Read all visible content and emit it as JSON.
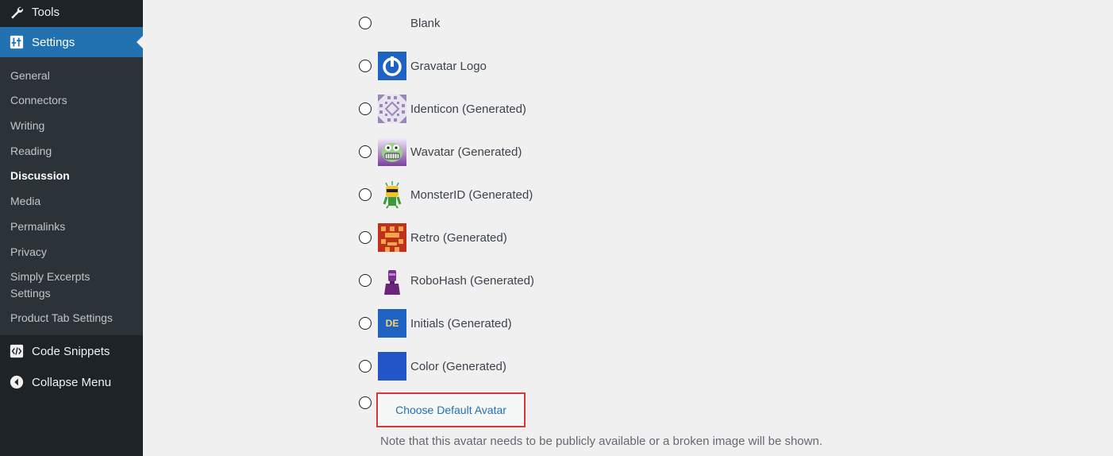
{
  "sidebar": {
    "tools_label": "Tools",
    "settings_label": "Settings",
    "items": [
      "General",
      "Connectors",
      "Writing",
      "Reading",
      "Discussion",
      "Media",
      "Permalinks",
      "Privacy",
      "Simply Excerpts",
      "Settings",
      "Product Tab Settings"
    ],
    "code_snippets_label": "Code Snippets",
    "collapse_label": "Collapse Menu",
    "accent": "#2271b1",
    "bg": "#1d2327"
  },
  "avatars": {
    "options": [
      {
        "label": "Blank",
        "icon": "blank"
      },
      {
        "label": "Gravatar Logo",
        "icon": "gravatar-logo"
      },
      {
        "label": "Identicon (Generated)",
        "icon": "identicon"
      },
      {
        "label": "Wavatar (Generated)",
        "icon": "wavatar"
      },
      {
        "label": "MonsterID (Generated)",
        "icon": "monsterid"
      },
      {
        "label": "Retro (Generated)",
        "icon": "retro"
      },
      {
        "label": "RoboHash (Generated)",
        "icon": "robohash"
      },
      {
        "label": "Initials (Generated)",
        "icon": "initials",
        "initials_text": "DE"
      },
      {
        "label": "Color (Generated)",
        "icon": "color"
      }
    ],
    "choose_button": "Choose Default Avatar",
    "note": "Note that this avatar needs to be publicly available or a broken image will be shown."
  }
}
